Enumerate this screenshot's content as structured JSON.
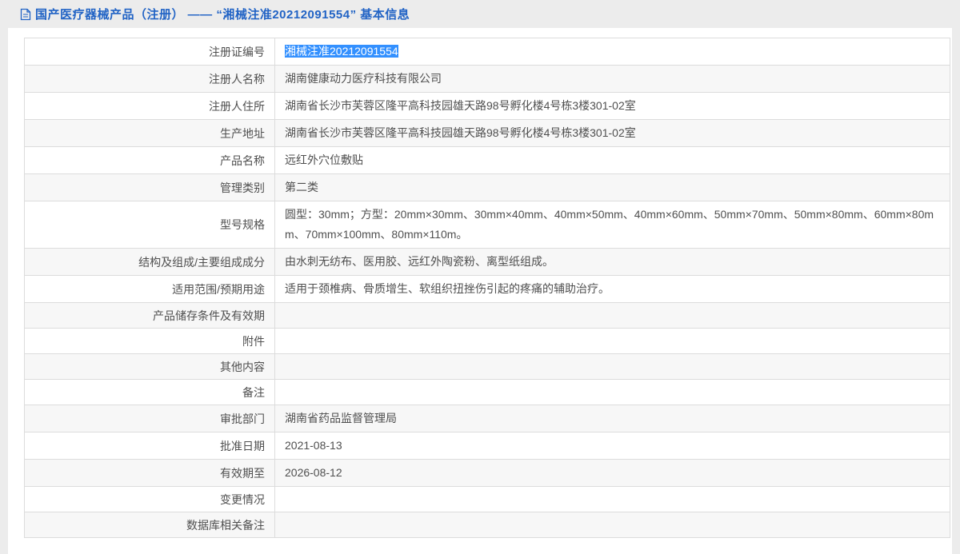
{
  "page": {
    "header": {
      "icon": "document-icon",
      "title": "国产医疗器械产品（注册） —— “湘械注准20212091554” 基本信息"
    },
    "colors": {
      "title_blue": "#2163c5",
      "selection_blue": "#3390ff",
      "header_bg": "#ececec",
      "row_alt_bg": "#f7f7f7",
      "table_border": "#dcdcdc",
      "text": "#4f4f4f"
    },
    "table": {
      "rows": [
        {
          "label": "注册证编号",
          "value": "湘械注准20212091554",
          "selected": true
        },
        {
          "label": "注册人名称",
          "value": "湖南健康动力医疗科技有限公司"
        },
        {
          "label": "注册人住所",
          "value": "湖南省长沙市芙蓉区隆平高科技园雄天路98号孵化楼4号栋3楼301-02室"
        },
        {
          "label": "生产地址",
          "value": "湖南省长沙市芙蓉区隆平高科技园雄天路98号孵化楼4号栋3楼301-02室"
        },
        {
          "label": "产品名称",
          "value": "远红外穴位敷贴"
        },
        {
          "label": "管理类别",
          "value": "第二类"
        },
        {
          "label": "型号规格",
          "value": "圆型：30mm；方型：20mm×30mm、30mm×40mm、40mm×50mm、40mm×60mm、50mm×70mm、50mm×80mm、60mm×80mm、70mm×100mm、80mm×110m。"
        },
        {
          "label": "结构及组成/主要组成成分",
          "value": "由水刺无纺布、医用胶、远红外陶瓷粉、离型纸组成。"
        },
        {
          "label": "适用范围/预期用途",
          "value": "适用于颈椎病、骨质增生、软组织扭挫伤引起的疼痛的辅助治疗。"
        },
        {
          "label": "产品储存条件及有效期",
          "value": ""
        },
        {
          "label": "附件",
          "value": ""
        },
        {
          "label": "其他内容",
          "value": ""
        },
        {
          "label": "备注",
          "value": ""
        },
        {
          "label": "审批部门",
          "value": "湖南省药品监督管理局"
        },
        {
          "label": "批准日期",
          "value": "2021-08-13"
        },
        {
          "label": "有效期至",
          "value": "2026-08-12"
        },
        {
          "label": "变更情况",
          "value": ""
        },
        {
          "label": "数据库相关备注",
          "value": ""
        }
      ]
    }
  }
}
